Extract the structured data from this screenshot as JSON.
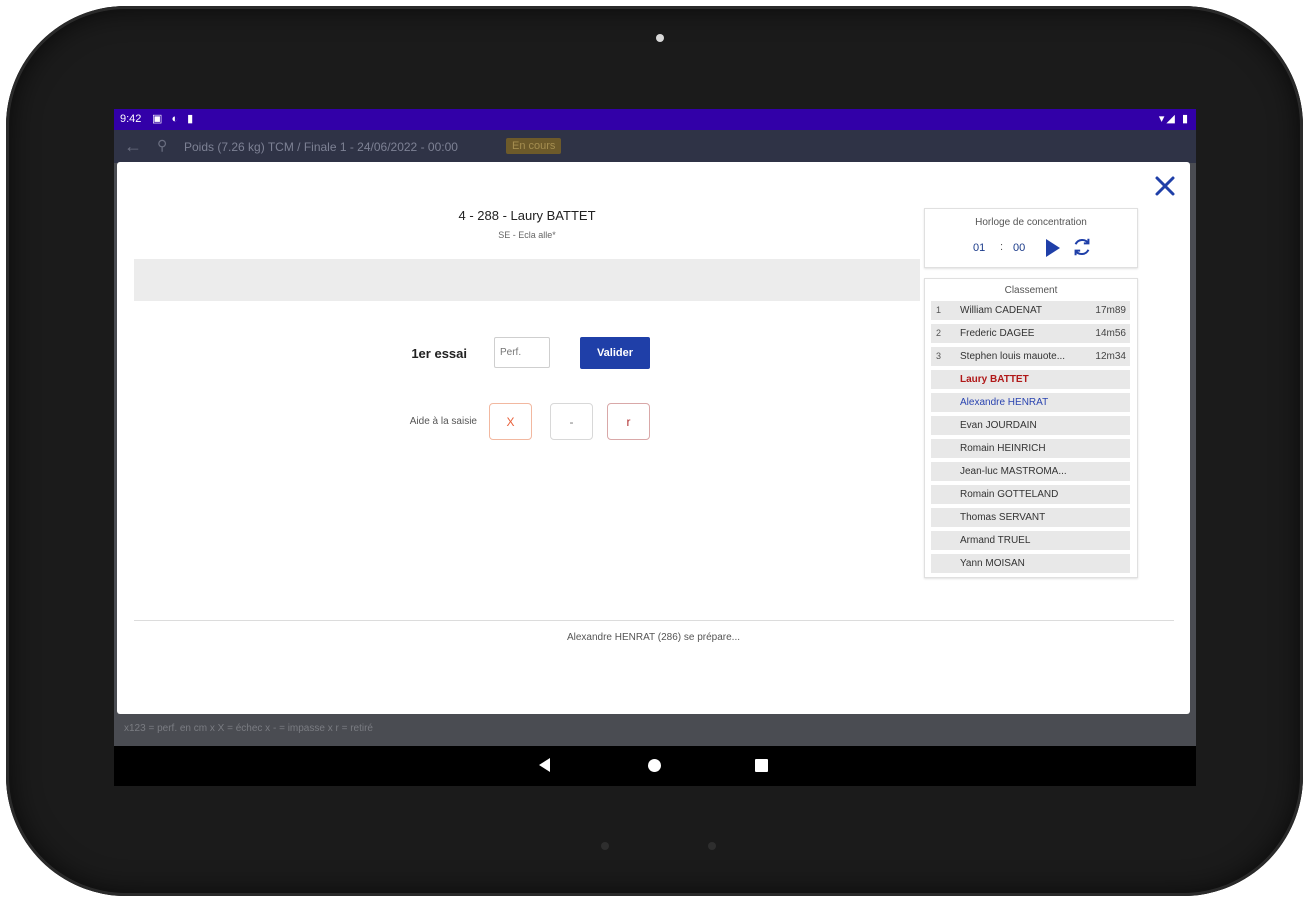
{
  "status_bar": {
    "time": "9:42"
  },
  "app_bar": {
    "title": "Poids (7.26 kg) TCM / Finale 1 - 24/06/2022 - 00:00",
    "badge": "En cours"
  },
  "behind_hint": "x123 = perf. en cm  x X = échec  x - = impasse  x r = retiré",
  "dialog": {
    "athlete_title": "4 - 288 - Laury BATTET",
    "athlete_sub": "SE - Ecla alle*",
    "attempt_label": "1er essai",
    "perf_placeholder": "Perf.",
    "validate_label": "Valider",
    "help_label": "Aide à la saisie",
    "help_buttons": [
      "X",
      "-",
      "r"
    ],
    "footer_message": "Alexandre HENRAT (286) se prépare..."
  },
  "clock": {
    "title": "Horloge de concentration",
    "minutes": "01",
    "separator": ":",
    "seconds": "00"
  },
  "ranking": {
    "title": "Classement",
    "rows": [
      {
        "pos": "1",
        "name": "William CADENAT",
        "perf": "17m89"
      },
      {
        "pos": "2",
        "name": "Frederic DAGEE",
        "perf": "14m56"
      },
      {
        "pos": "3",
        "name": "Stephen louis mauote...",
        "perf": "12m34"
      },
      {
        "pos": "",
        "name": "Laury BATTET",
        "perf": ""
      },
      {
        "pos": "",
        "name": "Alexandre HENRAT",
        "perf": ""
      },
      {
        "pos": "",
        "name": "Evan JOURDAIN",
        "perf": ""
      },
      {
        "pos": "",
        "name": "Romain HEINRICH",
        "perf": ""
      },
      {
        "pos": "",
        "name": "Jean-luc MASTROMA...",
        "perf": ""
      },
      {
        "pos": "",
        "name": "Romain GOTTELAND",
        "perf": ""
      },
      {
        "pos": "",
        "name": "Thomas SERVANT",
        "perf": ""
      },
      {
        "pos": "",
        "name": "Armand TRUEL",
        "perf": ""
      },
      {
        "pos": "",
        "name": "Yann MOISAN",
        "perf": ""
      }
    ]
  },
  "colors": {
    "status_bar": "#3200a8",
    "primary_button": "#1f3fa8",
    "current_athlete": "#b01818",
    "next_athlete": "#2a44b0"
  },
  "icons": {
    "close": "close-icon",
    "play": "play-icon",
    "reset": "refresh-icon"
  }
}
